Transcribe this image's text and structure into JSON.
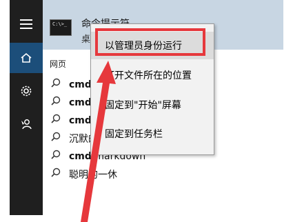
{
  "top_result": {
    "title": "命令提示符",
    "subtitle": "桌"
  },
  "section_label": "网页",
  "context_menu": {
    "items": [
      "以管理员身份运行",
      "打开文件所在的位置",
      "固定到\"开始\"屏幕",
      "固定到任务栏"
    ]
  },
  "results": [
    {
      "bold": "cmd",
      "rest": ""
    },
    {
      "bold": "cmd",
      "rest": ""
    },
    {
      "bold": "cmd",
      "rest": ""
    },
    {
      "bold": "",
      "rest": "沉默的羔羊"
    },
    {
      "bold": "cmd",
      "rest": " markdown"
    },
    {
      "bold": "",
      "rest": "聪明的一休"
    }
  ],
  "cmd_icon_text": "C:\\>_",
  "colors": {
    "rail": "#1f1f1f",
    "rail_selected": "#1c4e7a",
    "highlight": "#c8d6e3",
    "annotation": "#e6383c"
  },
  "icons": [
    "hamburger-icon",
    "home-icon",
    "gear-icon",
    "feedback-icon",
    "search-icon",
    "cmd-icon",
    "arrow-annotation"
  ]
}
